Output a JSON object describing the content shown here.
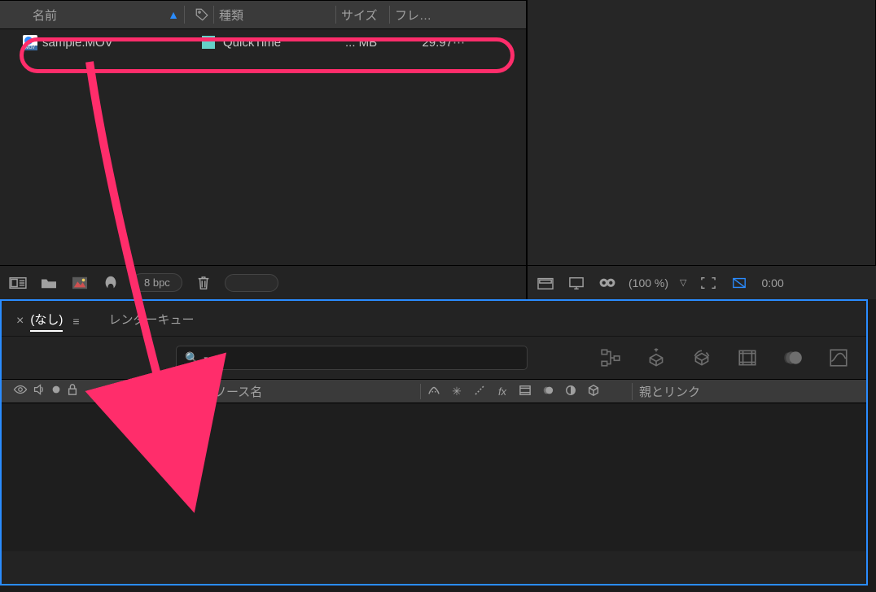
{
  "project_panel": {
    "columns": {
      "name": "名前",
      "kind": "種類",
      "size": "サイズ",
      "fps": "フレ…"
    },
    "row": {
      "filename": "sample.MOV",
      "kind": "QuickTime",
      "size": "... MB",
      "fps": "29.97"
    },
    "footer": {
      "bpc": "8 bpc"
    }
  },
  "viewer_footer": {
    "zoom": "(100 %)",
    "time": "0:00"
  },
  "timeline": {
    "tab_none": "(なし)",
    "tab_render": "レンダーキュー",
    "header_source": "ソース名",
    "header_parent": "親とリンク"
  }
}
